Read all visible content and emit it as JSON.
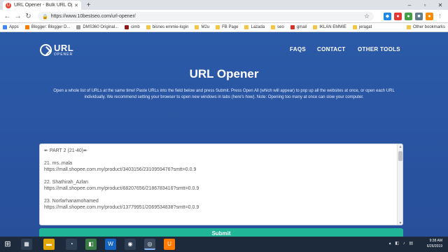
{
  "browser": {
    "tab_title": "URL Opener - Bulk URL Opener",
    "tab_favicon": "U",
    "address": "https://www.10bestseo.com/url-opener/",
    "bookmarks": [
      "Apps",
      "Blogger: Blogger D...",
      "DMS360 Original...",
      "cimb",
      "bisnes emmie-login",
      "M2u",
      "FB Page",
      "Lazada",
      "seo",
      "gmail",
      "IKLAN EMMIE",
      "jeragat"
    ],
    "other_bookmarks": "Other bookmarks"
  },
  "site": {
    "logo_main": "URL",
    "logo_sub": "OPENER",
    "nav": [
      "FAQS",
      "CONTACT",
      "OTHER TOOLS"
    ],
    "title": "URL Opener",
    "intro": "Open a whole list of URLs at the same time! Paste URLs into the field below and press Submit. Press Open All (which will appear) to pop up all the websites at once, or open each URL individually. We recommend setting your browser to open new windows in tabs (here's how). Note: Opening too many at once can slow your computer.",
    "textarea": {
      "header": "PART 2 (21-40)",
      "entries": [
        {
          "name": "21. ms..mala",
          "link": "https://mall.shopee.com.my/product/3403156/2310959476?smtt=0.0.9"
        },
        {
          "name": "22. Shathirah_Azlan",
          "link": "https://mall.shopee.com.my/product/68207656/2186783416?smtt=0.0.9"
        },
        {
          "name": "23. Norfarhanamohamed",
          "link": "https://mall.shopee.com.my/product/13779951/2069534838?smtt=0.0.9"
        }
      ]
    },
    "submit_label": "Submit"
  },
  "taskbar": {
    "time": "9:38 AM",
    "date": "6/26/2019"
  }
}
